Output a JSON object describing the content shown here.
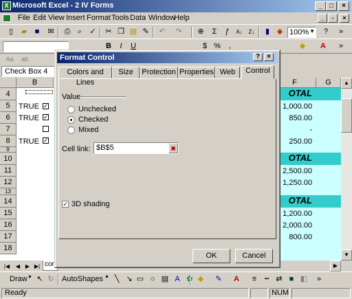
{
  "app": {
    "title": "Microsoft Excel - 2 IV Forms"
  },
  "menu": [
    "File",
    "Edit",
    "View",
    "Insert",
    "Format",
    "Tools",
    "Data",
    "Window",
    "Help"
  ],
  "menu_underline": [
    "F",
    "E",
    "V",
    "I",
    "o",
    "T",
    "D",
    "W",
    "H"
  ],
  "toolbar": {
    "zoom": "100%"
  },
  "namebox": "Check Box 4",
  "columns": {
    "b": "B",
    "f": "F",
    "g": "G"
  },
  "rows": [
    "4",
    "5",
    "6",
    "7",
    "8",
    "9",
    "10",
    "11",
    "12",
    "13",
    "14",
    "15",
    "16",
    "17",
    "18"
  ],
  "sheet": {
    "total_label": "OTAL",
    "true_label": "TRUE",
    "values": {
      "r5": "1,000.00",
      "r6": "850.00",
      "r7": "-",
      "r8": "250.00",
      "r11": "2,500.00",
      "r12": "1,250.00",
      "r15": "1,200.00",
      "r16": "2,000.00",
      "r17": "800.00"
    },
    "sheet_tab": "con"
  },
  "drawbar": {
    "draw_label": "Draw",
    "autoshapes_label": "AutoShapes"
  },
  "status": {
    "left": "Ready",
    "num": "NUM"
  },
  "dialog": {
    "title": "Format Control",
    "help_btn": "?",
    "close_btn": "×",
    "tabs": [
      "Colors and Lines",
      "Size",
      "Protection",
      "Properties",
      "Web",
      "Control"
    ],
    "active_tab": "Control",
    "value_group": "Value",
    "options": [
      "Unchecked",
      "Checked",
      "Mixed"
    ],
    "selected_option": "Checked",
    "cell_link_label": "Cell link:",
    "cell_link_value": "$B$5",
    "shading_label": "3D shading",
    "shading_checked": true,
    "ok_label": "OK",
    "cancel_label": "Cancel"
  }
}
